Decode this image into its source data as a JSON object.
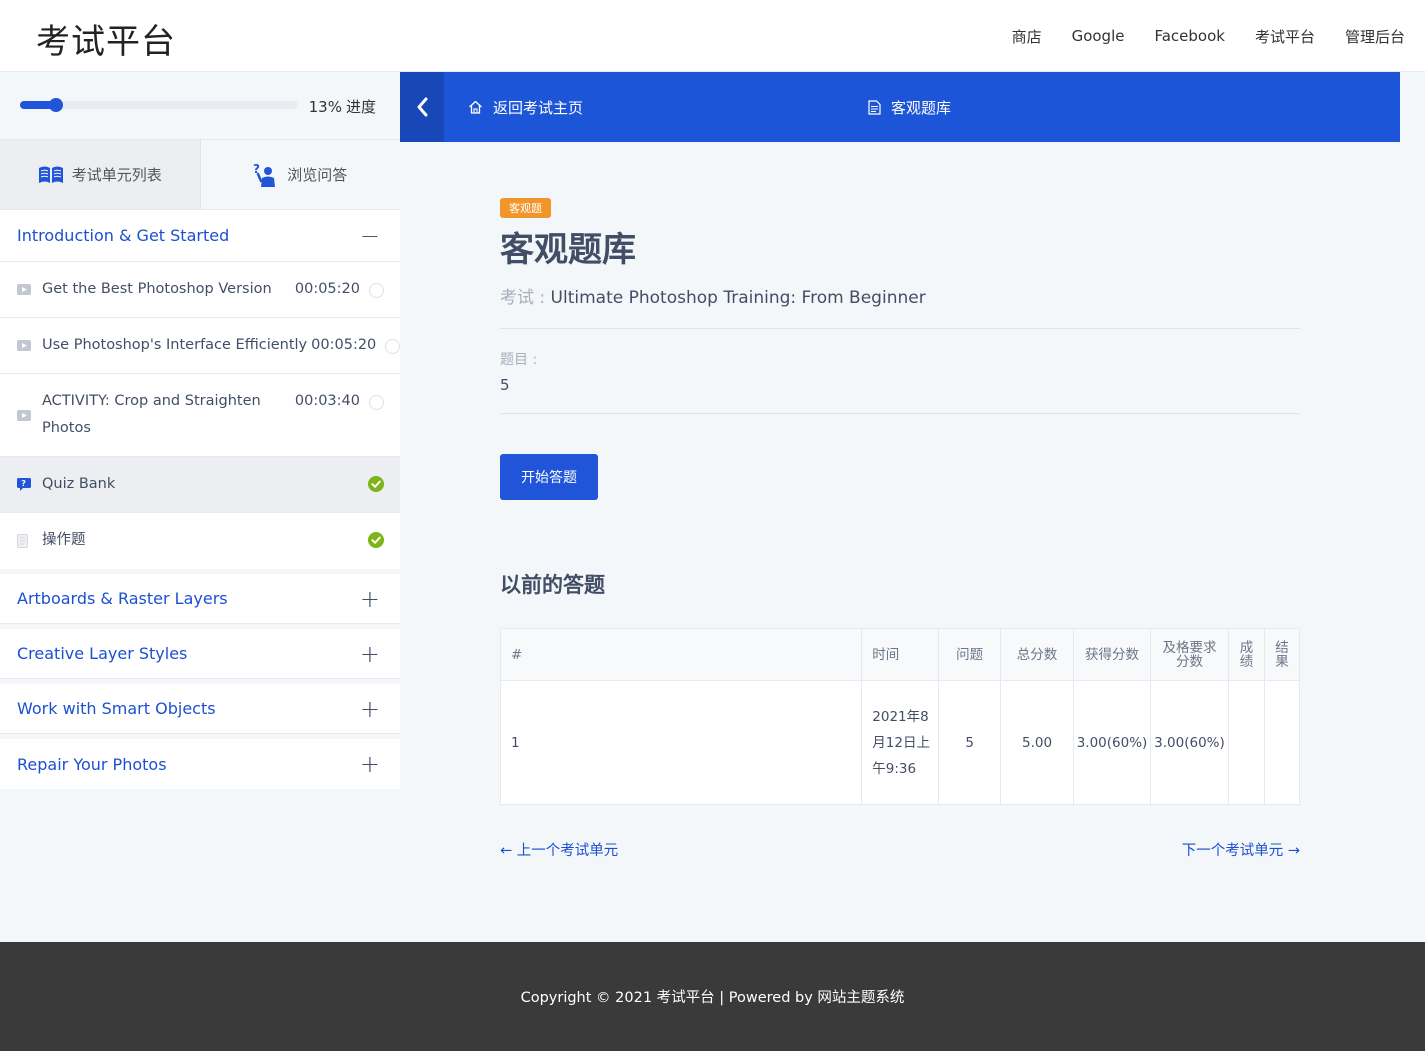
{
  "site": {
    "title": "考试平台"
  },
  "nav": {
    "items": [
      "商店",
      "Google",
      "Facebook",
      "考试平台",
      "管理后台"
    ]
  },
  "progress": {
    "percent": 13,
    "label": "13%",
    "suffix": "进度"
  },
  "side_tabs": {
    "units": "考试单元列表",
    "qa": "浏览问答"
  },
  "sections": [
    {
      "title": "Introduction & Get Started",
      "expanded": true,
      "lessons": [
        {
          "name": "Get the Best Photoshop Version",
          "duration": "00:05:20",
          "type": "video-icon",
          "done": false
        },
        {
          "name": "Use Photoshop's Interface Efficiently",
          "duration": "00:05:20",
          "type": "video-icon",
          "done": false
        },
        {
          "name": "ACTIVITY: Crop and Straighten Photos",
          "duration": "00:03:40",
          "type": "video-icon",
          "done": false
        },
        {
          "name": "Quiz Bank",
          "duration": "",
          "type": "quiz-icon",
          "done": true,
          "active": true
        },
        {
          "name": "操作题",
          "duration": "",
          "type": "document-icon",
          "done": true
        }
      ]
    },
    {
      "title": "Artboards & Raster Layers",
      "expanded": false
    },
    {
      "title": "Creative Layer Styles",
      "expanded": false
    },
    {
      "title": "Work with Smart Objects",
      "expanded": false
    },
    {
      "title": "Repair Your Photos",
      "expanded": false
    }
  ],
  "content_bar": {
    "back_home": "返回考试主页",
    "current": "客观题库"
  },
  "main": {
    "badge": "客观题",
    "title": "客观题库",
    "exam_label": "考试 :",
    "exam_name": "Ultimate Photoshop Training: From Beginner",
    "questions_label": "题目 :",
    "questions_value": "5",
    "start_button": "开始答题",
    "previous_title": "以前的答题"
  },
  "attempts": {
    "headers": [
      "#",
      "时间",
      "问题",
      "总分数",
      "获得分数",
      "及格要求分数",
      "成绩",
      "结果"
    ],
    "rows": [
      {
        "num": "1",
        "time": "2021年8月12日上午9:36",
        "questions": "5",
        "total": "5.00",
        "earned": "3.00(60%)",
        "pass": "3.00(60%)",
        "grade": "",
        "result": ""
      }
    ]
  },
  "pager": {
    "prev": "← 上一个考试单元",
    "next": "下一个考试单元 →"
  },
  "footer": {
    "text": "Copyright © 2021 考试平台 | Powered by 网站主题系统"
  },
  "colors": {
    "primary": "#1d55d8",
    "badge": "#f0962a",
    "check": "#7cb518"
  }
}
